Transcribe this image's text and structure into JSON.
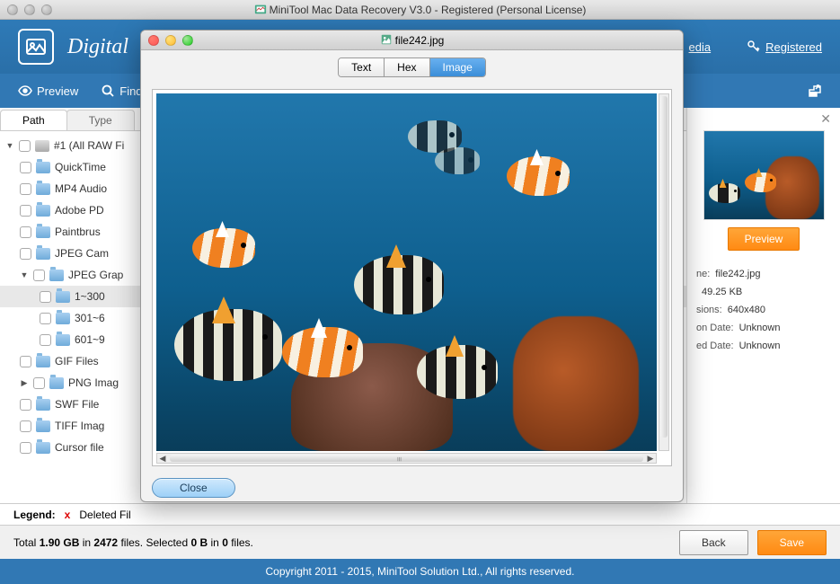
{
  "main_window": {
    "title": "MiniTool Mac Data Recovery V3.0 - Registered (Personal License)",
    "app_label": "Digital",
    "media_link": "edia",
    "registered_link": "Registered",
    "copyright": "Copyright 2011 - 2015, MiniTool Solution Ltd., All rights reserved."
  },
  "toolbar": {
    "preview": "Preview",
    "find": "Find"
  },
  "tabs": {
    "path": "Path",
    "type": "Type"
  },
  "tree": {
    "root": "#1 (All RAW Fi",
    "items": [
      "QuickTime",
      "MP4 Audio",
      "Adobe PD",
      "Paintbrus",
      "JPEG Cam",
      "JPEG Grap",
      "1~300",
      "301~6",
      "601~9",
      "GIF Files",
      "PNG Imag",
      "SWF File",
      "TIFF Imag",
      "Cursor file"
    ]
  },
  "info": {
    "preview_btn": "Preview",
    "filename_label": "ne:",
    "filename_value": "file242.jpg",
    "size_value": "49.25 KB",
    "dimensions_label": "sions:",
    "dimensions_value": "640x480",
    "creation_label": "on Date:",
    "creation_value": "Unknown",
    "modified_label": "ed Date:",
    "modified_value": "Unknown"
  },
  "legend": {
    "label": "Legend:",
    "deleted": "Deleted Fil"
  },
  "status": {
    "text_prefix": "Total ",
    "total_size": "1.90 GB",
    "text_mid1": " in ",
    "total_files": "2472",
    "text_mid2": " files.   Selected ",
    "sel_size": "0 B",
    "text_mid3": " in ",
    "sel_files": "0",
    "text_suffix": " files.",
    "back": "Back",
    "save": "Save"
  },
  "modal": {
    "title": "file242.jpg",
    "tabs": {
      "text": "Text",
      "hex": "Hex",
      "image": "Image"
    },
    "close": "Close"
  }
}
